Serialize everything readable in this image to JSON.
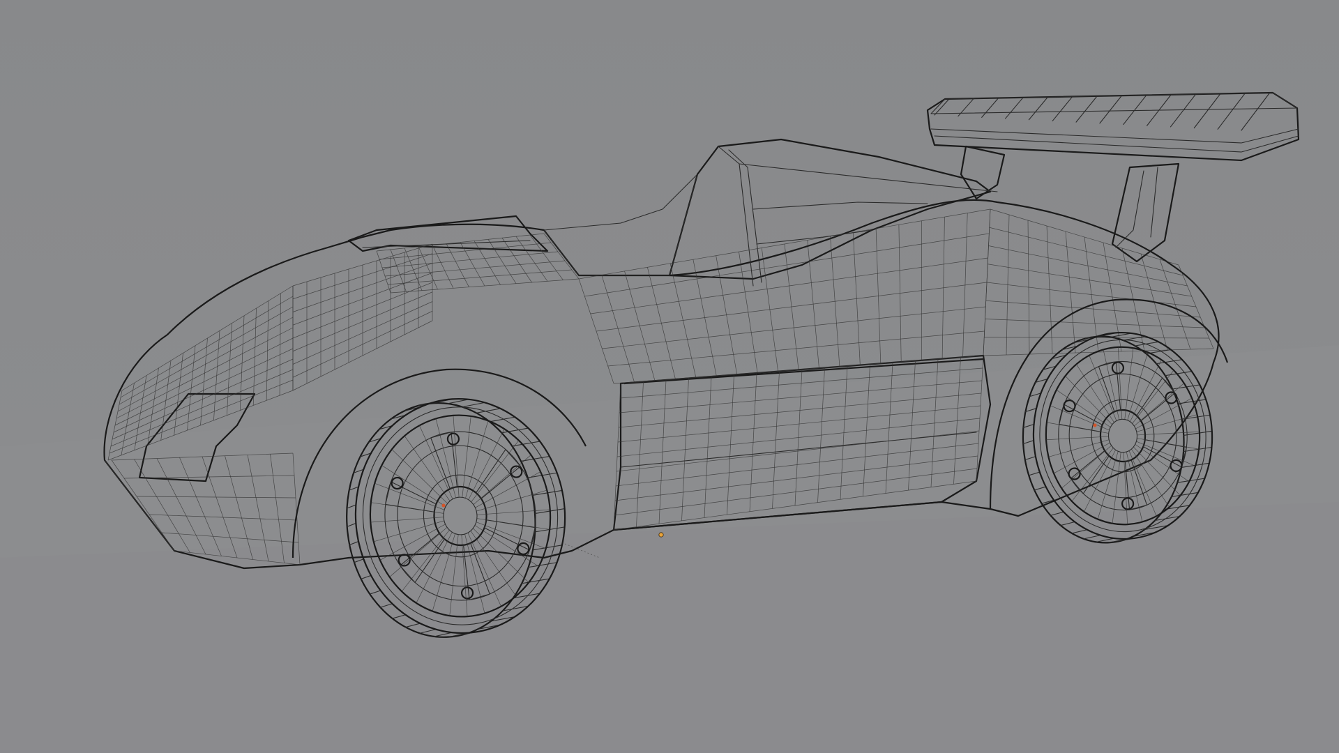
{
  "viewport": {
    "mode": "wireframe-overlay",
    "subject": "car-mesh",
    "background_color": "#8a8b8d",
    "floor_color": "#8e8f91",
    "mesh_fill_light": "#a9aaac",
    "mesh_fill_mid": "#9b9c9e",
    "mesh_fill_dark": "#7e7f81",
    "wire_color": "#2b2b2b",
    "vertex_markers": [
      {
        "color": "#e8a33a"
      },
      {
        "color": "#d4552a"
      },
      {
        "color": "#d4552a"
      }
    ]
  }
}
